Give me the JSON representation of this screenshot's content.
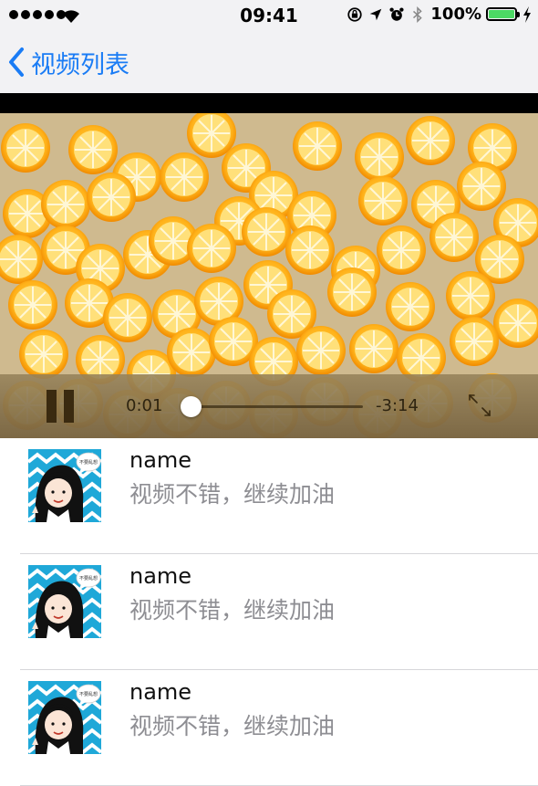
{
  "status_bar": {
    "time": "09:41",
    "battery_percent": "100%",
    "battery_level": 1.0,
    "icons": [
      "signal-dots-icon",
      "wifi-icon",
      "rotation-lock-icon",
      "location-arrow-icon",
      "alarm-icon",
      "bluetooth-icon",
      "battery-icon",
      "charging-bolt-icon"
    ]
  },
  "nav": {
    "back_label": "视频列表",
    "accent_color": "#1a7cf5"
  },
  "player": {
    "state": "playing",
    "control_icon": "pause-icon",
    "elapsed": "0:01",
    "remaining": "-3:14",
    "progress": 0.005,
    "fullscreen_icon": "expand-arrows-icon"
  },
  "comments": [
    {
      "name": "name",
      "text": "视频不错，继续加油",
      "avatar_icon": "cartoon-girl-avatar",
      "avatar_badge": "不要乱想"
    },
    {
      "name": "name",
      "text": "视频不错，继续加油",
      "avatar_icon": "cartoon-girl-avatar",
      "avatar_badge": "不要乱想"
    },
    {
      "name": "name",
      "text": "视频不错，继续加油",
      "avatar_icon": "cartoon-girl-avatar",
      "avatar_badge": "不要乱想"
    }
  ]
}
